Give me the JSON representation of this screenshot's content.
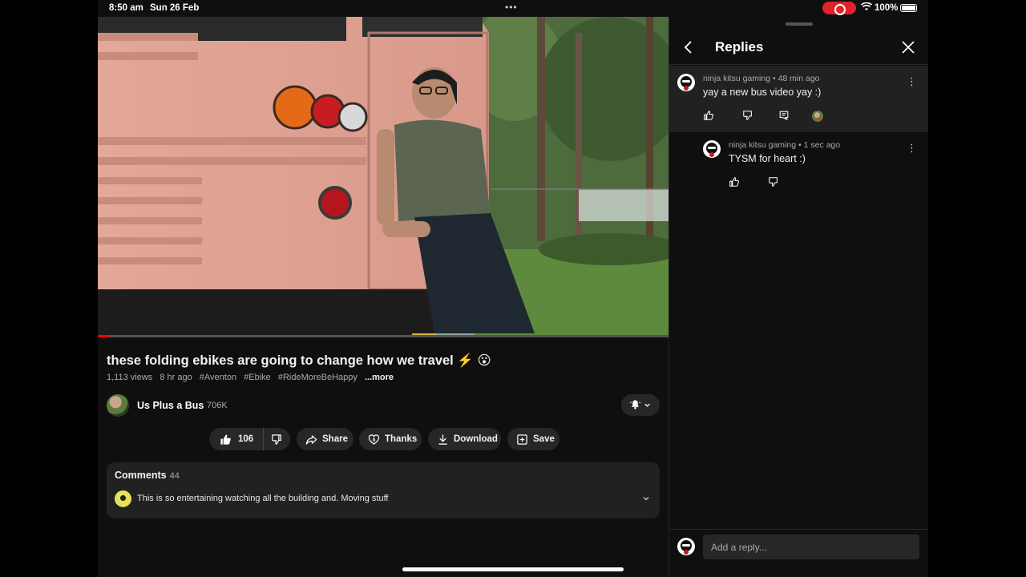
{
  "status_bar": {
    "time": "8:50 am",
    "date": "Sun 26 Feb",
    "dots": "•••",
    "battery": "100%"
  },
  "video": {
    "title": "these folding ebikes are going to change how we travel ⚡️ 😮",
    "views": "1,113 views",
    "age": "8 hr ago",
    "hashtags": [
      "#Aventon",
      "#Ebike",
      "#RideMoreBeHappy"
    ],
    "more_label": "...more",
    "progress": 0.02
  },
  "channel": {
    "name": "Us Plus a Bus",
    "subscribers": "706K"
  },
  "actions": {
    "like_count": "106",
    "share": "Share",
    "thanks": "Thanks",
    "download": "Download",
    "save": "Save"
  },
  "comments": {
    "header": "Comments",
    "count": "44",
    "preview": "This is so entertaining watching all the building and. Moving stuff"
  },
  "replies_panel": {
    "title": "Replies",
    "parent": {
      "author": "ninja kitsu gaming",
      "age": "48 min ago",
      "text": "yay a new bus video yay :)"
    },
    "reply": {
      "author": "ninja kitsu gaming",
      "age": "1 sec ago",
      "text": "TYSM for heart :)"
    },
    "input_placeholder": "Add a reply..."
  },
  "colors": {
    "background": "#0f0f0f",
    "pill": "#272727",
    "accent_red": "#ff0000",
    "record": "#e0232a"
  }
}
